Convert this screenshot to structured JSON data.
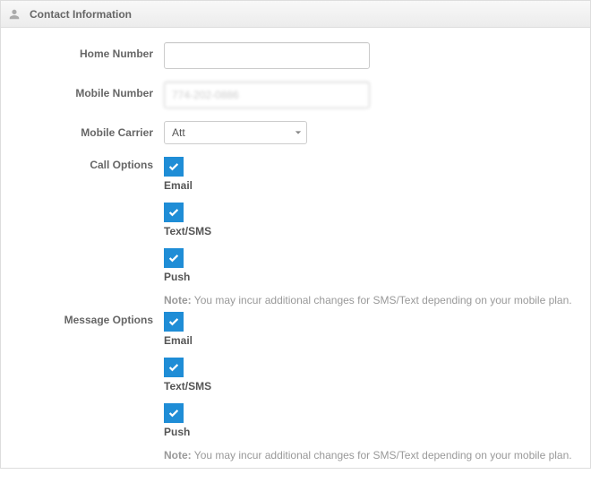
{
  "header": {
    "title": "Contact Information"
  },
  "fields": {
    "homeNumber": {
      "label": "Home Number",
      "value": ""
    },
    "mobileNumber": {
      "label": "Mobile Number",
      "value": "774-202-0886"
    },
    "mobileCarrier": {
      "label": "Mobile Carrier",
      "selected": "Att"
    }
  },
  "callOptions": {
    "label": "Call Options",
    "items": [
      {
        "label": "Email",
        "checked": true
      },
      {
        "label": "Text/SMS",
        "checked": true
      },
      {
        "label": "Push",
        "checked": true
      }
    ],
    "noteLabel": "Note:",
    "noteText": " You may incur additional changes for SMS/Text depending on your mobile plan."
  },
  "messageOptions": {
    "label": "Message Options",
    "items": [
      {
        "label": "Email",
        "checked": true
      },
      {
        "label": "Text/SMS",
        "checked": true
      },
      {
        "label": "Push",
        "checked": true
      }
    ],
    "noteLabel": "Note:",
    "noteText": " You may incur additional changes for SMS/Text depending on your mobile plan."
  }
}
